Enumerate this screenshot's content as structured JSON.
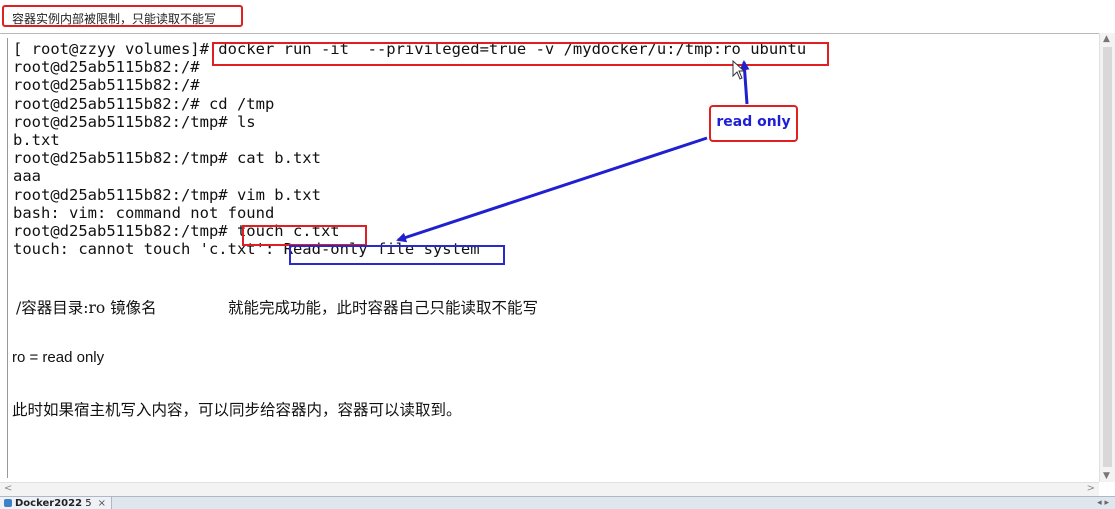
{
  "top_note": "容器实例内部被限制，只能读取不能写",
  "terminal": {
    "lines": [
      "[ root@zzyy volumes]# docker run -it  --privileged=true -v /mydocker/u:/tmp:ro ubuntu",
      "root@d25ab5115b82:/#",
      "root@d25ab5115b82:/#",
      "root@d25ab5115b82:/# cd /tmp",
      "root@d25ab5115b82:/tmp# ls",
      "b.txt",
      "root@d25ab5115b82:/tmp# cat b.txt",
      "aaa",
      "root@d25ab5115b82:/tmp# vim b.txt",
      "bash: vim: command not found",
      "root@d25ab5115b82:/tmp# touch c.txt",
      "touch: cannot touch 'c.txt': Read-only file system"
    ]
  },
  "callout": "read only",
  "notes": {
    "line1_left": "/容器目录:ro 镜像名",
    "line1_right": "就能完成功能，此时容器自己只能读取不能写",
    "line2": "ro = read only",
    "line3": "此时如果宿主机写入内容，可以同步给容器内，容器可以读取到。"
  },
  "taskbar": {
    "tab_label": "Docker2022",
    "tab_suffix": "5",
    "close_glyph": "×"
  },
  "colors": {
    "red_box": "#e02020",
    "blue_box": "#2a2acc",
    "arrow": "#2020d0",
    "callout_text": "#1f1fd6"
  }
}
